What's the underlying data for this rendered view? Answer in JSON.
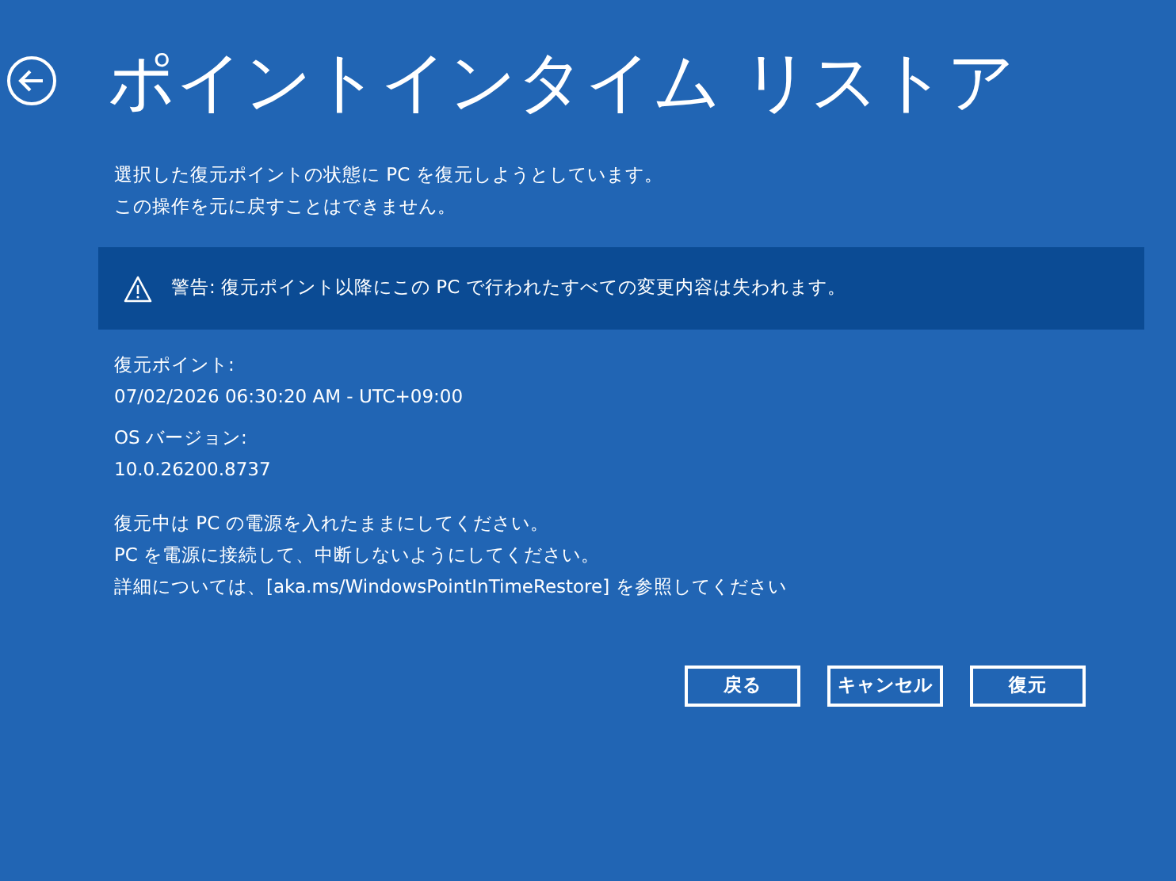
{
  "title": "ポイントインタイム リストア",
  "intro": [
    "選択した復元ポイントの状態に PC を復元しようとしています。",
    "この操作を元に戻すことはできません。"
  ],
  "warning": "警告: 復元ポイント以降にこの PC で行われたすべての変更内容は失われます。",
  "details": [
    {
      "label": "復元ポイント:",
      "value": "07/02/2026 06:30:20 AM - UTC+09:00"
    },
    {
      "label": "OS バージョン:",
      "value": "10.0.26200.8737"
    }
  ],
  "notes": [
    "復元中は PC の電源を入れたままにしてください。",
    "PC を電源に接続して、中断しないようにしてください。",
    "詳細については、[aka.ms/WindowsPointInTimeRestore] を参照してください"
  ],
  "buttons": [
    "戻る",
    "キャンセル",
    "復元"
  ]
}
